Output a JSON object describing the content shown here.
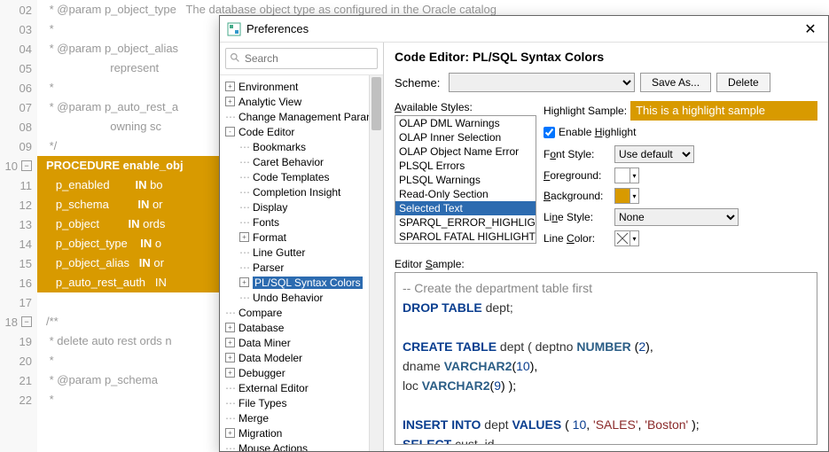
{
  "dialog": {
    "title": "Preferences",
    "search_placeholder": "Search",
    "panel_title": "Code Editor: PL/SQL Syntax Colors",
    "scheme_label": "Scheme:",
    "save_as_btn": "Save As...",
    "delete_btn": "Delete",
    "avail_styles_label": "Available Styles:",
    "highlight_sample_label": "Highlight Sample:",
    "highlight_sample_text": "This is a highlight sample",
    "enable_highlight": "Enable Highlight",
    "font_style_label": "Font Style:",
    "font_style_value": "Use default",
    "foreground_label": "Foreground:",
    "background_label": "Background:",
    "line_style_label": "Line Style:",
    "line_style_value": "None",
    "line_color_label": "Line Color:",
    "editor_sample_label": "Editor Sample:",
    "foreground_color": "#ffffff",
    "background_color": "#d89a00"
  },
  "tree": [
    {
      "label": "Environment",
      "level": 0,
      "exp": "+"
    },
    {
      "label": "Analytic View",
      "level": 0,
      "exp": "+"
    },
    {
      "label": "Change Management Paran",
      "level": 0,
      "dots": true
    },
    {
      "label": "Code Editor",
      "level": 0,
      "exp": "-"
    },
    {
      "label": "Bookmarks",
      "level": 1,
      "dots": true
    },
    {
      "label": "Caret Behavior",
      "level": 1,
      "dots": true
    },
    {
      "label": "Code Templates",
      "level": 1,
      "dots": true
    },
    {
      "label": "Completion Insight",
      "level": 1,
      "dots": true
    },
    {
      "label": "Display",
      "level": 1,
      "dots": true
    },
    {
      "label": "Fonts",
      "level": 1,
      "dots": true
    },
    {
      "label": "Format",
      "level": 1,
      "exp": "+"
    },
    {
      "label": "Line Gutter",
      "level": 1,
      "dots": true
    },
    {
      "label": "Parser",
      "level": 1,
      "dots": true
    },
    {
      "label": "PL/SQL Syntax Colors",
      "level": 1,
      "exp": "+",
      "sel": true
    },
    {
      "label": "Undo Behavior",
      "level": 1,
      "dots": true
    },
    {
      "label": "Compare",
      "level": 0,
      "dots": true
    },
    {
      "label": "Database",
      "level": 0,
      "exp": "+"
    },
    {
      "label": "Data Miner",
      "level": 0,
      "exp": "+"
    },
    {
      "label": "Data Modeler",
      "level": 0,
      "exp": "+"
    },
    {
      "label": "Debugger",
      "level": 0,
      "exp": "+"
    },
    {
      "label": "External Editor",
      "level": 0,
      "dots": true
    },
    {
      "label": "File Types",
      "level": 0,
      "dots": true
    },
    {
      "label": "Merge",
      "level": 0,
      "dots": true
    },
    {
      "label": "Migration",
      "level": 0,
      "exp": "+"
    },
    {
      "label": "Mouse Actions",
      "level": 0,
      "dots": true
    }
  ],
  "styles": [
    {
      "label": "OLAP DML Warnings"
    },
    {
      "label": "OLAP Inner Selection"
    },
    {
      "label": "OLAP Object Name Error"
    },
    {
      "label": "PLSQL Errors"
    },
    {
      "label": "PLSQL Warnings"
    },
    {
      "label": "Read-Only Section"
    },
    {
      "label": "Selected Text",
      "sel": true
    },
    {
      "label": "SPARQL_ERROR_HIGHLIGHT_"
    },
    {
      "label": "SPAROL FATAL HIGHLIGHT S"
    }
  ],
  "sample": {
    "l1_cmt": "-- Create the department table first",
    "l2": {
      "kw": "DROP TABLE",
      "id": " dept;"
    },
    "l3": {
      "kw": "CREATE TABLE",
      "id": " dept ( deptno ",
      "ty": "NUMBER",
      "par1": " (",
      "num": "2",
      "par2": "),"
    },
    "l4": {
      "pad": "                       dname ",
      "ty": "VARCHAR2",
      "par1": "(",
      "num": "10",
      "par2": "),"
    },
    "l5": {
      "pad": "                       loc ",
      "ty": "VARCHAR2",
      "par1": "(",
      "num": "9",
      "par2": ") );"
    },
    "l6": {
      "kw1": "INSERT INTO",
      "id1": " dept ",
      "kw2": "VALUES",
      "open": " ( ",
      "n1": "10",
      "c1": ", ",
      "s1": "'SALES'",
      "c2": ", ",
      "s2": "'Boston'",
      "close": " );"
    },
    "l7": {
      "kw": "SELECT",
      "id": " cust_id"
    }
  },
  "bg_code": [
    {
      "ln": "02",
      "txt": " * @param p_object_type   The database object type as configured in the Oracle catalog"
    },
    {
      "ln": "03",
      "txt": " *"
    },
    {
      "ln": "04",
      "txt": " * @param p_object_alias"
    },
    {
      "ln": "05",
      "txt": "                    represent"
    },
    {
      "ln": "06",
      "txt": " *"
    },
    {
      "ln": "07",
      "txt": " * @param p_auto_rest_a"
    },
    {
      "ln": "08",
      "txt": "                    owning sc"
    },
    {
      "ln": "09",
      "txt": " */"
    },
    {
      "ln": "10",
      "txt": "PROCEDURE enable_obj",
      "sel": true,
      "bold": true,
      "fold": true
    },
    {
      "ln": "11",
      "txt": "   p_enabled        IN bo",
      "sel": true
    },
    {
      "ln": "12",
      "txt": "   p_schema         IN or",
      "sel": true
    },
    {
      "ln": "13",
      "txt": "   p_object         IN ords",
      "sel": true
    },
    {
      "ln": "14",
      "txt": "   p_object_type    IN o",
      "sel": true
    },
    {
      "ln": "15",
      "txt": "   p_object_alias   IN or",
      "sel": true
    },
    {
      "ln": "16",
      "txt": "   p_auto_rest_auth   IN",
      "sel": true
    },
    {
      "ln": "17",
      "txt": ""
    },
    {
      "ln": "18",
      "txt": "/**",
      "fold": true
    },
    {
      "ln": "19",
      "txt": " * delete auto rest ords n"
    },
    {
      "ln": "20",
      "txt": " *"
    },
    {
      "ln": "21",
      "txt": " * @param p_schema"
    },
    {
      "ln": "22",
      "txt": " *"
    }
  ]
}
